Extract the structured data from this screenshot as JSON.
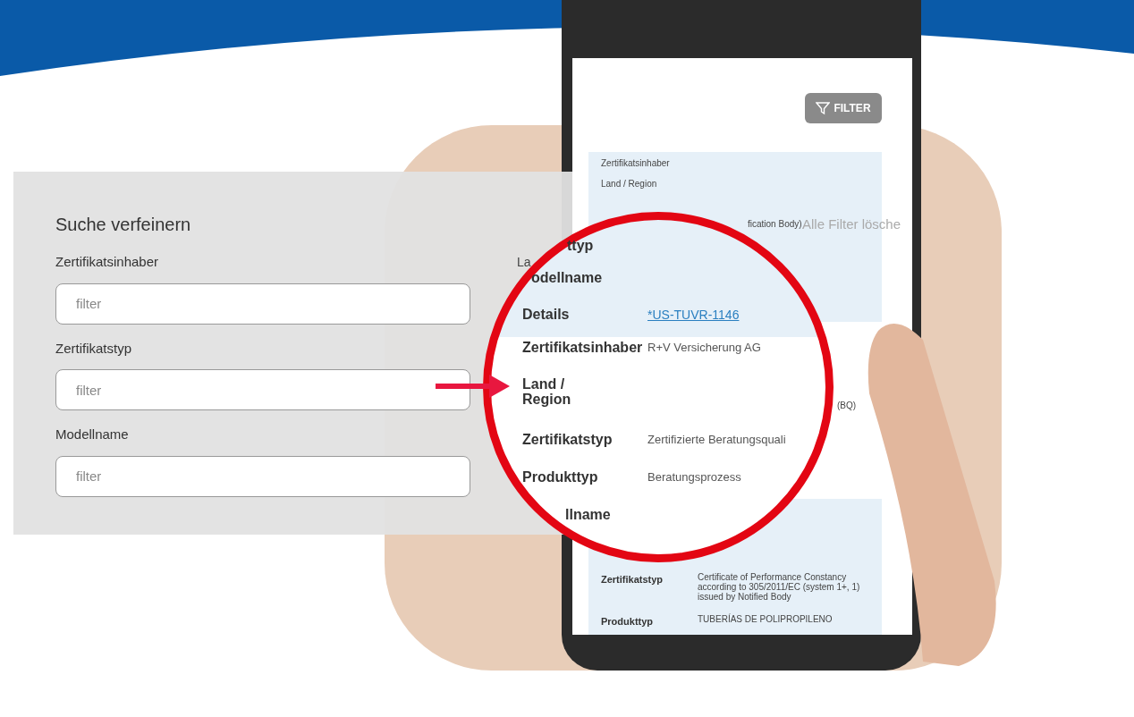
{
  "search_panel": {
    "title": "Suche verfeinern",
    "fields": [
      {
        "label": "Zertifikatsinhaber",
        "placeholder": "filter"
      },
      {
        "label": "Zertifikatstyp",
        "placeholder": "filter"
      },
      {
        "label": "Modellname",
        "placeholder": "filter"
      }
    ]
  },
  "phone": {
    "filter_button": "FILTER",
    "clear_filters": "Alle Filter lösche",
    "partial_label": "La",
    "top_card": {
      "rows": [
        "Zertifikatsinhaber",
        "Land / Region"
      ],
      "fragment": "fication Body)"
    },
    "side_fragment": "(BQ)",
    "bottom_card": {
      "rows": [
        {
          "label": "Zertifikatstyp",
          "value": "Certificate of Performance Constancy according to 305/2011/EC (system 1+, 1) issued by Notified Body"
        },
        {
          "label": "Produkttyp",
          "value": "TUBERÍAS DE POLIPROPILENO"
        }
      ]
    }
  },
  "magnifier": {
    "rows": [
      {
        "label": "ttyp"
      },
      {
        "label": "odellname"
      },
      {
        "label": "Details",
        "value": "*US-TUVR-1146",
        "kind": "link"
      },
      {
        "label": "Zertifikatsinhaber",
        "value": "R+V Versicherung AG",
        "kind": "text"
      },
      {
        "label": "Land / Region"
      },
      {
        "label": "Zertifikatstyp",
        "value": "Zertifizierte Beratungsquali",
        "kind": "text"
      },
      {
        "label": "Produkttyp",
        "value": "Beratungsprozess",
        "kind": "text"
      },
      {
        "label": "llname"
      }
    ]
  }
}
